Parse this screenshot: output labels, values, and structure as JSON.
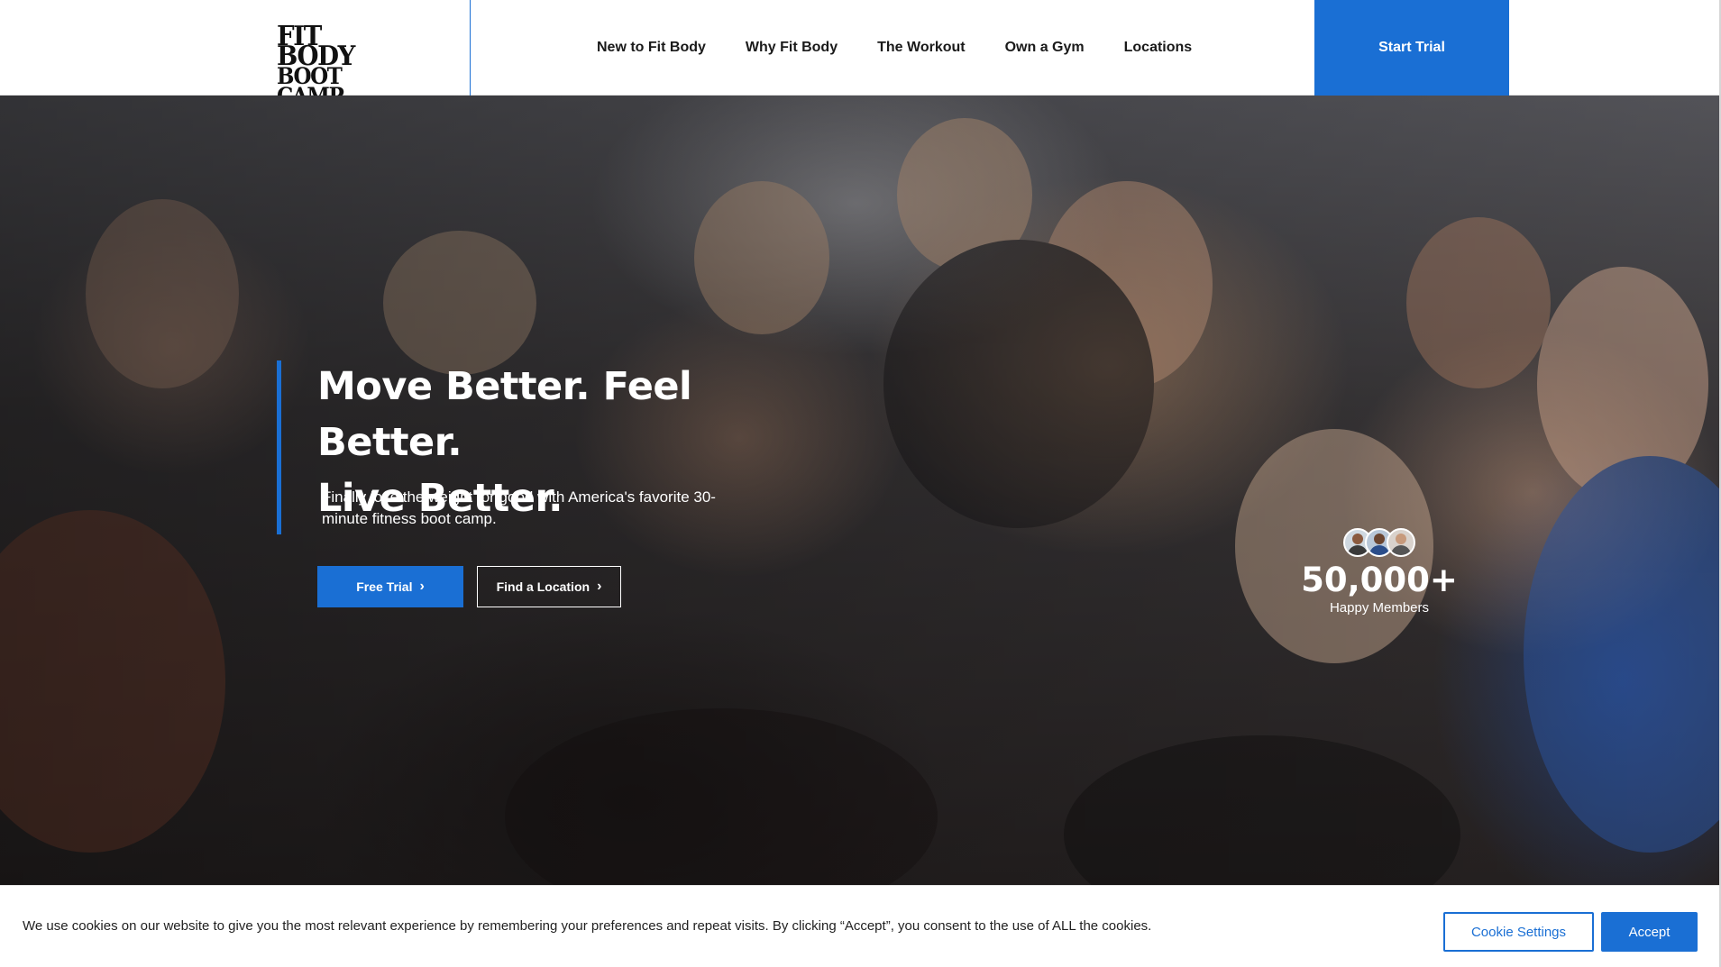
{
  "brand": {
    "logo_line1": "FIT BODY",
    "logo_line2": "BOOT CAMP",
    "accent_color": "#1a6fd4"
  },
  "nav": {
    "items": [
      {
        "label": "New to Fit Body"
      },
      {
        "label": "Why Fit Body"
      },
      {
        "label": "The Workout"
      },
      {
        "label": "Own a Gym"
      },
      {
        "label": "Locations"
      }
    ],
    "cta_label": "Start Trial"
  },
  "hero": {
    "headline_line1": "Move Better. Feel Better.",
    "headline_line2": "Live Better.",
    "subtext": "Finally lose the weight for good with America's favorite 30-minute fitness boot camp.",
    "primary_button": "Free Trial",
    "secondary_button": "Find a Location",
    "button_icon": "chevron-right-icon",
    "members_count": "50,000+",
    "members_label": "Happy Members"
  },
  "cookie_banner": {
    "text": "We use cookies on our website to give you the most relevant experience by remembering your preferences and repeat visits. By clicking “Accept”, you consent to the use of ALL the cookies.",
    "settings_label": "Cookie Settings",
    "accept_label": "Accept"
  }
}
